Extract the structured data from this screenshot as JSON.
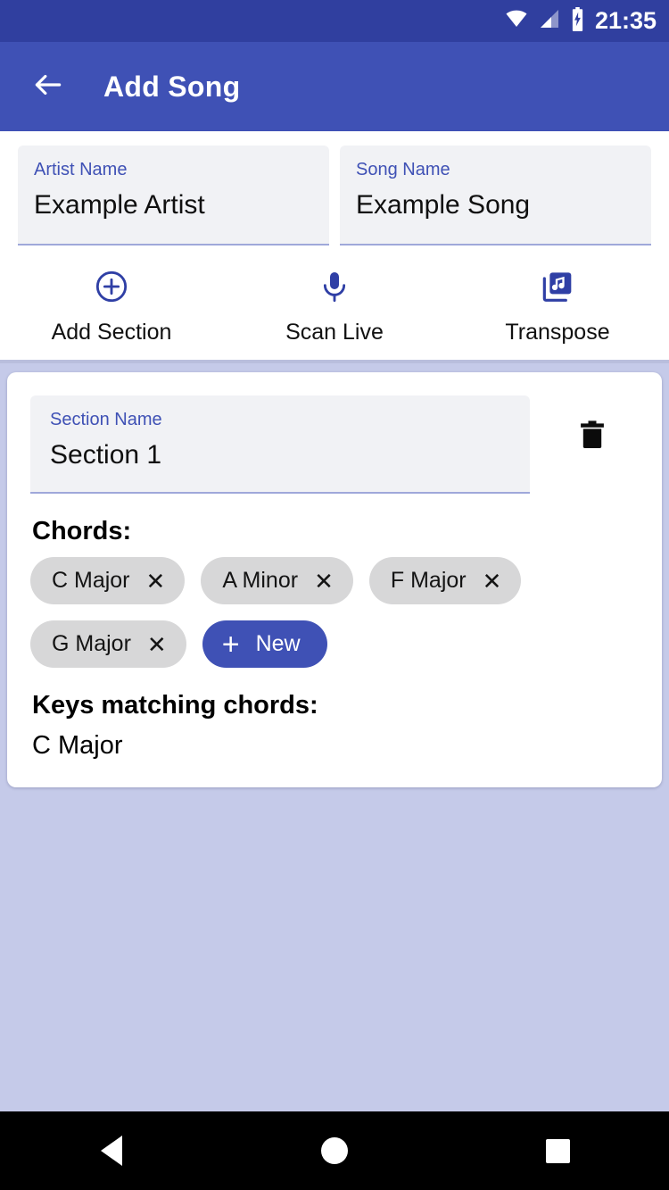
{
  "status_bar": {
    "time": "21:35",
    "icons": [
      "wifi-icon",
      "cellular-signal-icon",
      "battery-charging-icon"
    ],
    "background_color": "#303f9f"
  },
  "app_bar": {
    "title": "Add Song",
    "back_icon": "arrow-left-icon",
    "background_color": "#3f51b5"
  },
  "song_fields": [
    {
      "label": "Artist Name",
      "value": "Example Artist",
      "placeholder": "Artist Name"
    },
    {
      "label": "Song Name",
      "value": "Example Song",
      "placeholder": "Song Name"
    }
  ],
  "actions": [
    {
      "label": "Add Section",
      "icon": "plus-circle-icon"
    },
    {
      "label": "Scan Live",
      "icon": "microphone-icon"
    },
    {
      "label": "Transpose",
      "icon": "music-library-icon"
    }
  ],
  "section": {
    "name_label": "Section Name",
    "name_value": "Section 1",
    "name_placeholder": "Section Name",
    "delete_icon": "trash-icon",
    "chords_heading": "Chords:",
    "chords": [
      {
        "name": "C Major",
        "remove_icon": "close-icon"
      },
      {
        "name": "A Minor",
        "remove_icon": "close-icon"
      },
      {
        "name": "F Major",
        "remove_icon": "close-icon"
      },
      {
        "name": "G Major",
        "remove_icon": "close-icon"
      }
    ],
    "new_chord_label": "New",
    "new_chord_icon": "plus-icon",
    "keys_heading": "Keys matching chords:",
    "keys_value": "C Major"
  },
  "nav_bar": {
    "back": "back-triangle-icon",
    "home": "home-circle-icon",
    "recents": "recents-square-icon"
  },
  "colors": {
    "primary": "#3f51b5",
    "primary_dark": "#303f9f",
    "background": "#c5cae9",
    "chip": "#d7d7d8",
    "field_fill": "#f1f2f5"
  }
}
